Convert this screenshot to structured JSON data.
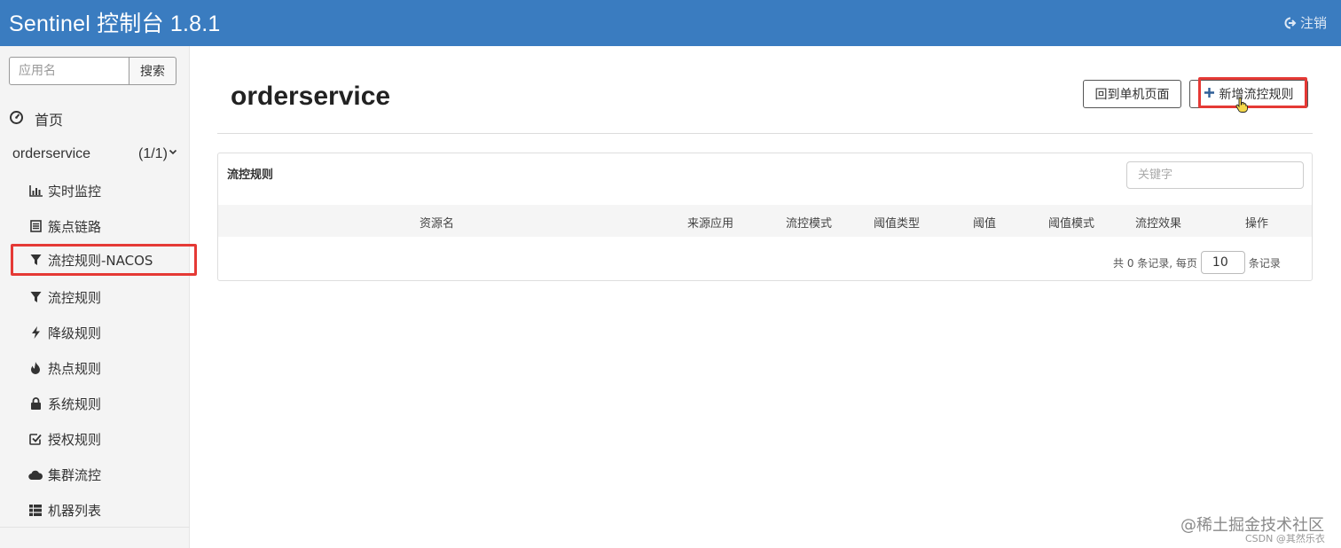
{
  "header": {
    "title": "Sentinel 控制台 1.8.1",
    "logout_label": "注销"
  },
  "sidebar": {
    "search_placeholder": "应用名",
    "search_button": "搜索",
    "home_label": "首页",
    "app_name": "orderservice",
    "app_count": "(1/1)",
    "items": [
      {
        "label": "实时监控",
        "icon": "bar-chart-icon"
      },
      {
        "label": "簇点链路",
        "icon": "list-icon"
      },
      {
        "label": "流控规则-NACOS",
        "icon": "filter-icon",
        "active": true
      },
      {
        "label": "流控规则",
        "icon": "filter-icon"
      },
      {
        "label": "降级规则",
        "icon": "bolt-icon"
      },
      {
        "label": "热点规则",
        "icon": "fire-icon"
      },
      {
        "label": "系统规则",
        "icon": "lock-icon"
      },
      {
        "label": "授权规则",
        "icon": "check-square-icon"
      },
      {
        "label": "集群流控",
        "icon": "cloud-icon"
      },
      {
        "label": "机器列表",
        "icon": "th-list-icon"
      }
    ]
  },
  "main": {
    "page_title": "orderservice",
    "back_button": "回到单机页面",
    "add_button": "新增流控规则",
    "panel": {
      "title": "流控规则",
      "keyword_placeholder": "关键字",
      "columns": [
        "资源名",
        "来源应用",
        "流控模式",
        "阈值类型",
        "阈值",
        "阈值模式",
        "流控效果",
        "操作"
      ],
      "pager_prefix": "共 0 条记录, 每页",
      "page_size": "10",
      "pager_suffix": "条记录"
    }
  },
  "watermark": {
    "site": "@稀土掘金技术社区",
    "author": "CSDN @其然乐衣"
  },
  "colors": {
    "header_bg": "#3a7cc0",
    "highlight": "#e53935"
  }
}
